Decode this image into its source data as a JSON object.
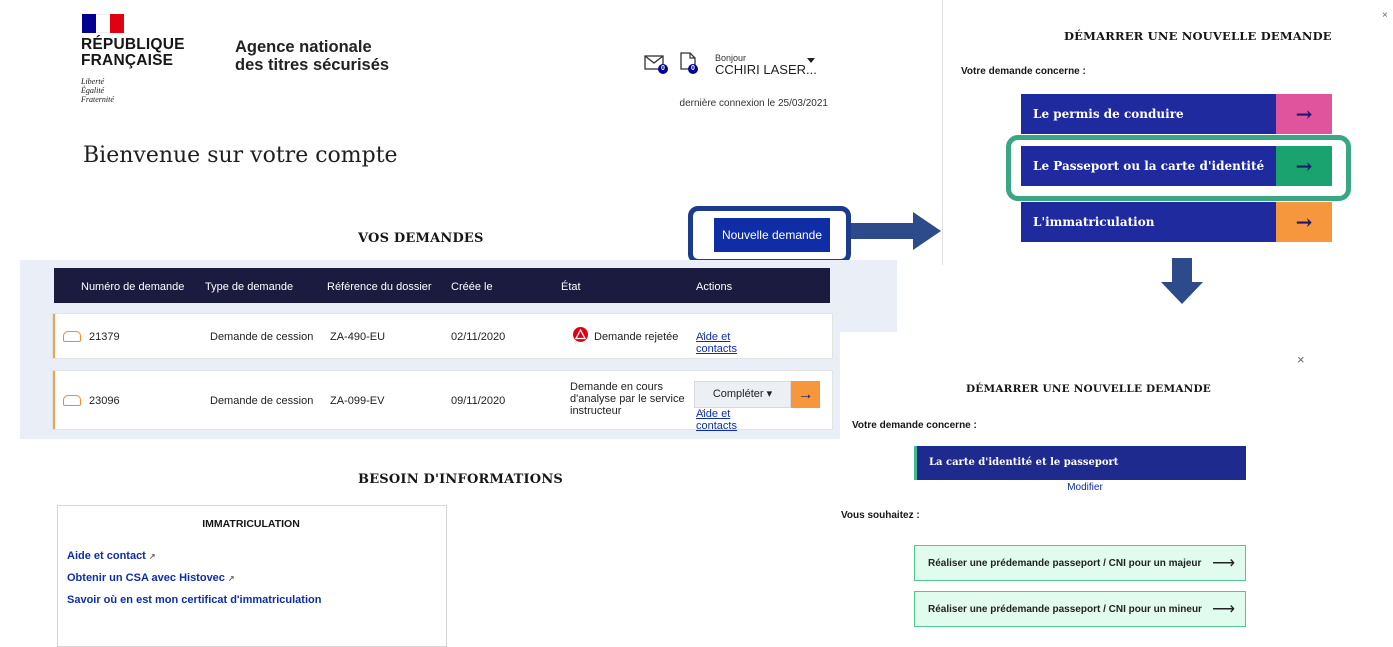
{
  "header": {
    "republic": "RÉPUBLIQUE\nFRANÇAISE",
    "republic_line1": "RÉPUBLIQUE",
    "republic_line2": "FRANÇAISE",
    "motto_1": "Liberté",
    "motto_2": "Égalité",
    "motto_3": "Fraternité",
    "agency_line1": "Agence nationale",
    "agency_line2": "des titres sécurisés",
    "mail_count": "0",
    "doc_count": "0",
    "greeting": "Bonjour",
    "user_name": "CCHIRI LASER...",
    "last_login": "dernière connexion le 25/03/2021",
    "flag_colors": [
      "#000091",
      "#ffffff",
      "#e1000f"
    ]
  },
  "welcome_title": "Bienvenue sur votre compte",
  "requests": {
    "title": "VOS DEMANDES",
    "new_button": "Nouvelle demande",
    "columns": [
      "Numéro de demande",
      "Type de demande",
      "Référence du dossier",
      "Créée le",
      "État",
      "Actions"
    ],
    "rows": [
      {
        "number": "21379",
        "type": "Demande de cession",
        "ref": "ZA-490-EU",
        "date": "02/11/2020",
        "state": "Demande rejetée",
        "action_link": "Aide et contacts"
      },
      {
        "number": "23096",
        "type": "Demande de cession",
        "ref": "ZA-099-EV",
        "date": "09/11/2020",
        "state_l1": "Demande en cours",
        "state_l2": "d'analyse par le service",
        "state_l3": "instructeur",
        "complete_label": "Compléter",
        "action_link": "Aide et contacts"
      }
    ]
  },
  "info": {
    "title": "BESOIN D'INFORMATIONS",
    "box_title": "IMMATRICULATION",
    "links": [
      "Aide et contact",
      "Obtenir un CSA avec Histovec",
      "Savoir où en est mon certificat d'immatriculation"
    ]
  },
  "modal1": {
    "title": "DÉMARRER UNE NOUVELLE DEMANDE",
    "question": "Votre demande concerne :",
    "choices": [
      {
        "label": "Le permis de conduire",
        "color": "#e0549e"
      },
      {
        "label": "Le Passeport ou la carte d'identité",
        "color": "#1aa36e"
      },
      {
        "label": "L'immatriculation",
        "color": "#f6963d"
      }
    ],
    "close": "×"
  },
  "modal2": {
    "close": "×",
    "title": "DÉMARRER UNE NOUVELLE DEMANDE",
    "question": "Votre demande concerne :",
    "selected": "La carte d'identité et le passeport",
    "modify": "Modifier",
    "wish": "Vous souhaitez :",
    "options": [
      "Réaliser une prédemande passeport / CNI pour un majeur",
      "Réaliser une prédemande passeport / CNI pour un mineur"
    ]
  }
}
